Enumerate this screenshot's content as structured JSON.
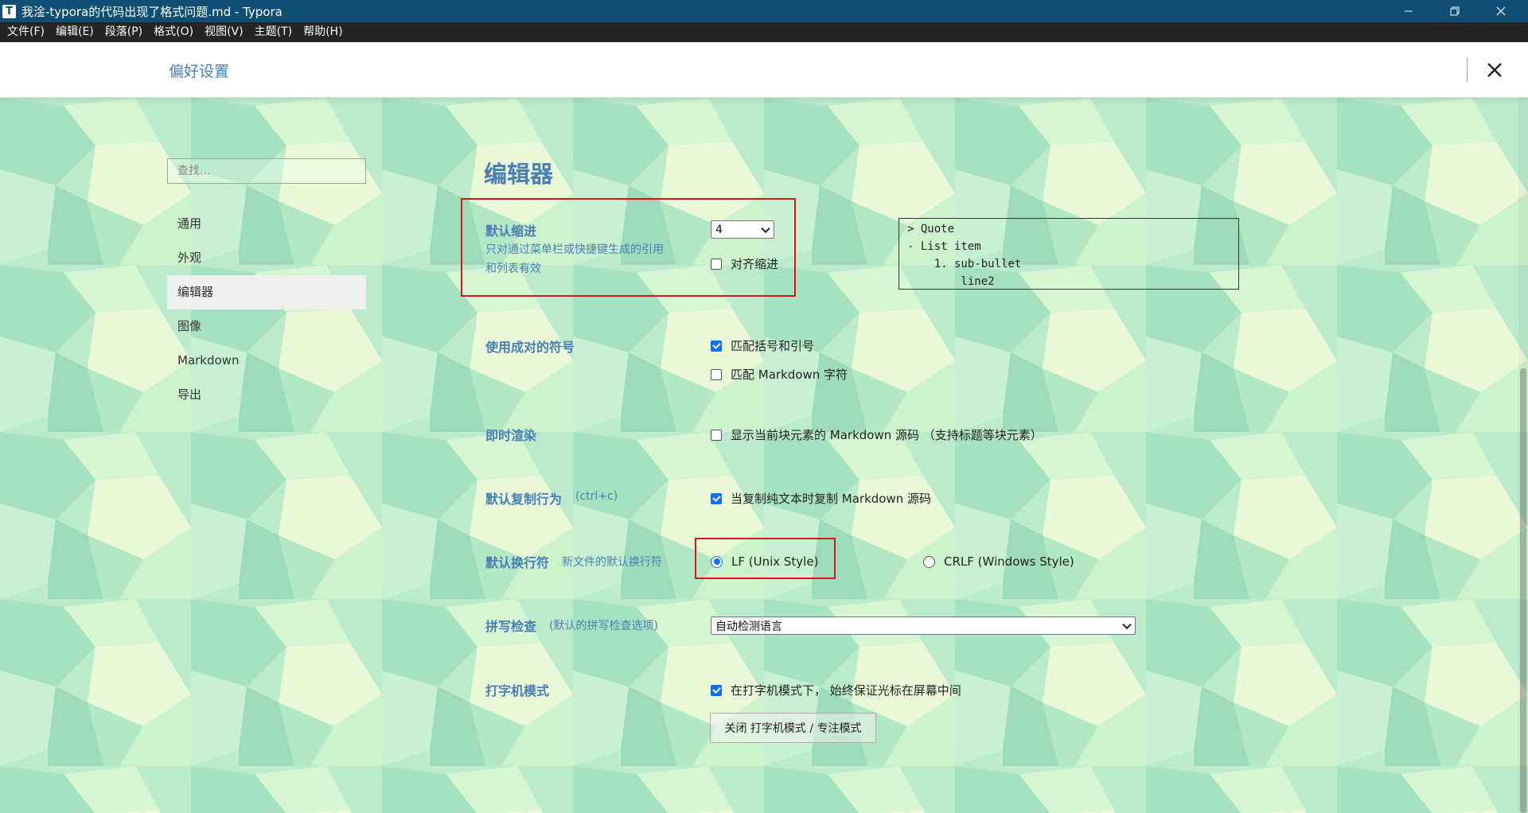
{
  "window": {
    "app_icon_letter": "T",
    "title": "我淦-typora的代码出现了格式问题.md - Typora"
  },
  "menu": [
    "文件(F)",
    "编辑(E)",
    "段落(P)",
    "格式(O)",
    "视图(V)",
    "主题(T)",
    "帮助(H)"
  ],
  "preferences": {
    "title": "偏好设置"
  },
  "sidebar": {
    "search_placeholder": "查找...",
    "items": [
      "通用",
      "外观",
      "编辑器",
      "图像",
      "Markdown",
      "导出"
    ],
    "active_index": 2
  },
  "editor": {
    "section_title": "编辑器",
    "indent": {
      "label": "默认缩进",
      "description": [
        "只对通过菜单栏或快捷键生成的引用",
        "和列表有效"
      ],
      "value": "4",
      "align_label": "对齐缩进",
      "align_checked": false,
      "preview_lines": [
        "> Quote",
        "- List item",
        "    1. sub-bullet",
        "        line2"
      ]
    },
    "pairs": {
      "label": "使用成对的符号",
      "match_brackets_label": "匹配括号和引号",
      "match_brackets_checked": true,
      "match_markdown_label": "匹配 Markdown 字符",
      "match_markdown_checked": false
    },
    "live_render": {
      "label": "即时渲染",
      "show_source_label": "显示当前块元素的 Markdown 源码 （支持标题等块元素）",
      "show_source_checked": false
    },
    "copy": {
      "label": "默认复制行为",
      "hint": "(ctrl+c)",
      "copy_source_label": "当复制纯文本时复制 Markdown 源码",
      "copy_source_checked": true
    },
    "line_ending": {
      "label": "默认换行符",
      "hint": "新文件的默认换行符",
      "lf_label": "LF (Unix Style)",
      "crlf_label": "CRLF (Windows Style)",
      "selected": "lf"
    },
    "spellcheck": {
      "label": "拼写检查",
      "hint": "(默认的拼写检查选项)",
      "value": "自动检测语言"
    },
    "typewriter": {
      "label": "打字机模式",
      "keep_center_label": "在打字机模式下， 始终保证光标在屏幕中间",
      "keep_center_checked": true,
      "toggle_button_label": "关闭 打字机模式 / 专注模式"
    }
  },
  "colors": {
    "accent": "#4a7fb6",
    "title_bar": "#0f4f73",
    "menu_bar": "#242424",
    "highlight_box": "#e0121b",
    "checkbox": "#0d6efd"
  }
}
